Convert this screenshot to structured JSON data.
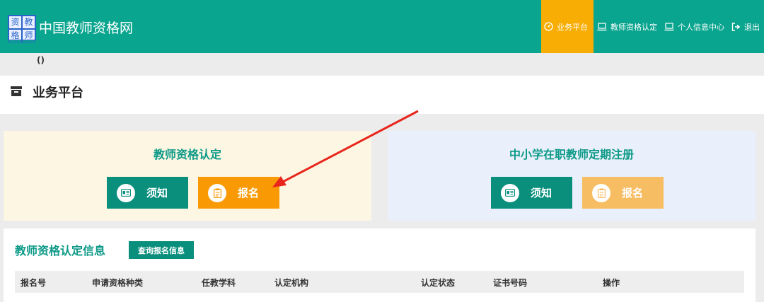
{
  "header": {
    "logo_chars": [
      "资",
      "教",
      "格",
      "师"
    ],
    "site_title": "中国教师资格网",
    "nav": [
      {
        "icon": "dashboard-icon",
        "label": "业务平台",
        "active": true
      },
      {
        "icon": "monitor-icon",
        "label": "教师资格认定",
        "active": false
      },
      {
        "icon": "monitor-icon",
        "label": "个人信息中心",
        "active": false
      },
      {
        "icon": "logout-icon",
        "label": "退出",
        "active": false
      }
    ]
  },
  "sub_strip": {
    "text": "()"
  },
  "page": {
    "title": "业务平台",
    "icon": "archive-box-icon"
  },
  "cards": [
    {
      "title": "教师资格认定",
      "buttons": [
        {
          "label": "须知",
          "icon": "id-card-icon"
        },
        {
          "label": "报名",
          "icon": "clipboard-icon"
        }
      ]
    },
    {
      "title": "中小学在职教师定期注册",
      "buttons": [
        {
          "label": "须知",
          "icon": "id-card-icon"
        },
        {
          "label": "报名",
          "icon": "clipboard-icon"
        }
      ]
    }
  ],
  "info": {
    "title": "教师资格认定信息",
    "query_button": "查询报名信息",
    "columns": [
      "报名号",
      "申请资格种类",
      "任教学科",
      "认定机构",
      "认定状态",
      "证书号码",
      "操作"
    ]
  },
  "colors": {
    "brand_teal": "#0aa58f",
    "button_teal": "#0a8f7d",
    "active_nav": "#f7ad04",
    "orange": "#f99a05",
    "arrow_red": "#e8261c"
  }
}
